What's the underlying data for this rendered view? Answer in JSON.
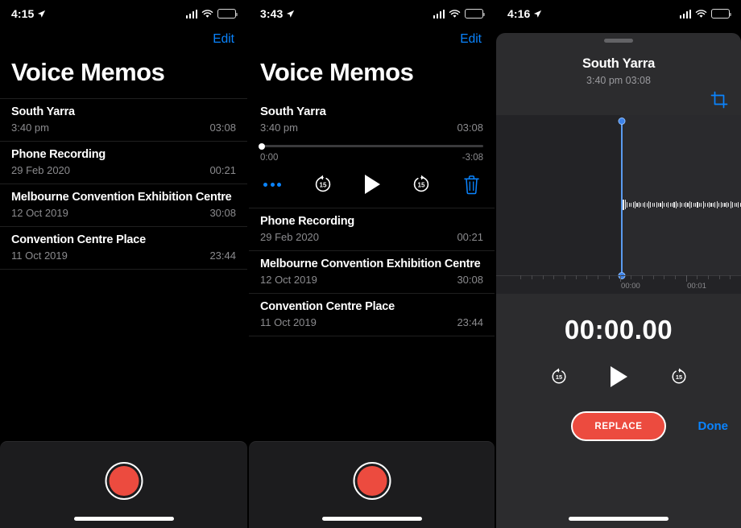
{
  "panels": [
    {
      "status": {
        "time": "4:15",
        "location_icon": "location-arrow-icon",
        "signal_icon": "cellular-bars-icon",
        "wifi_icon": "wifi-icon",
        "battery_icon": "battery-icon"
      },
      "nav": {
        "edit_label": "Edit"
      },
      "title": "Voice Memos",
      "memos": [
        {
          "title": "South Yarra",
          "date": "3:40 pm",
          "duration": "03:08"
        },
        {
          "title": "Phone Recording",
          "date": "29 Feb 2020",
          "duration": "00:21"
        },
        {
          "title": "Melbourne Convention Exhibition Centre",
          "date": "12 Oct 2019",
          "duration": "30:08"
        },
        {
          "title": "Convention Centre Place",
          "date": "11 Oct 2019",
          "duration": "23:44"
        }
      ],
      "record_button": "record-button"
    },
    {
      "status": {
        "time": "3:43"
      },
      "nav": {
        "edit_label": "Edit"
      },
      "title": "Voice Memos",
      "selected": {
        "title": "South Yarra",
        "date": "3:40 pm",
        "duration": "03:08",
        "elapsed": "0:00",
        "remaining": "-3:08",
        "progress_percent": 0
      },
      "controls": {
        "more_label": "more-options",
        "skip_back_label": "15",
        "play_label": "play",
        "skip_forward_label": "15",
        "delete_label": "delete"
      },
      "memos": [
        {
          "title": "Phone Recording",
          "date": "29 Feb 2020",
          "duration": "00:21"
        },
        {
          "title": "Melbourne Convention Exhibition Centre",
          "date": "12 Oct 2019",
          "duration": "30:08"
        },
        {
          "title": "Convention Centre Place",
          "date": "11 Oct 2019",
          "duration": "23:44"
        }
      ]
    },
    {
      "status": {
        "time": "4:16"
      },
      "sheet": {
        "title": "South Yarra",
        "subtitle": "3:40 pm  03:08",
        "crop_icon": "crop-trim-icon",
        "ruler_labels": [
          "00:00",
          "00:01"
        ],
        "timer": "00:00.00",
        "skip_back_label": "15",
        "skip_forward_label": "15",
        "replace_label": "REPLACE",
        "done_label": "Done"
      }
    }
  ],
  "colors": {
    "accent_blue": "#0a84ff",
    "record_red": "#ec4b3f",
    "sheet_bg": "#2c2c2e",
    "secondary_text": "#8b8b8e"
  }
}
